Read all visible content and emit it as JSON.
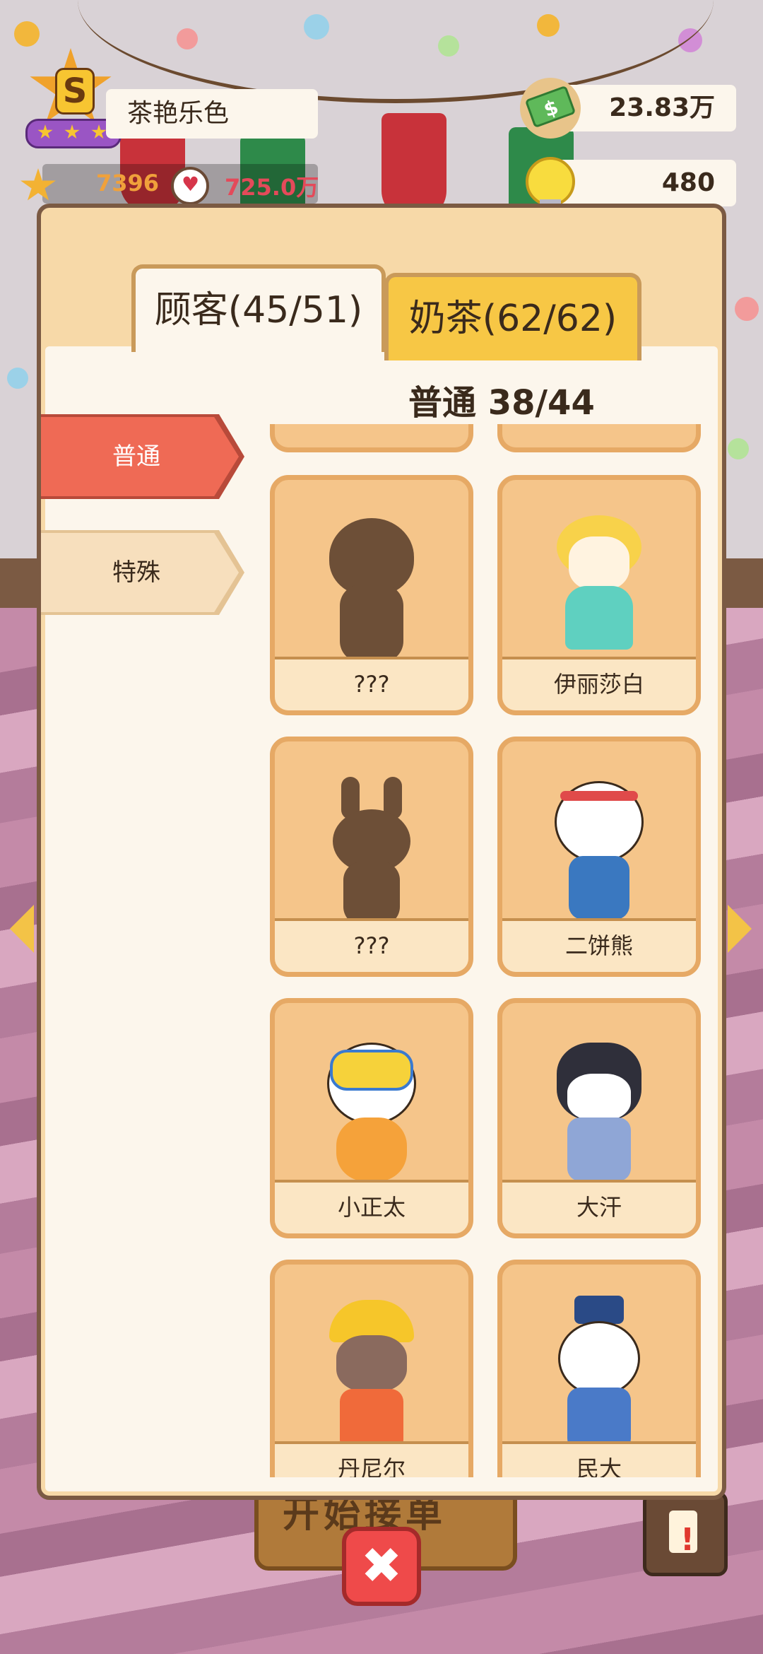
{
  "player": {
    "rank_letter": "S",
    "shop_name": "茶艳乐色",
    "stars": "7396",
    "fans": "725.0万"
  },
  "currency": {
    "money": "23.83万",
    "ideas": "480"
  },
  "tabs": [
    {
      "label": "顾客(45/51)",
      "active": true
    },
    {
      "label": "奶茶(62/62)",
      "active": false
    }
  ],
  "section": {
    "title": "普通 38/44"
  },
  "categories": [
    {
      "label": "普通",
      "active": true
    },
    {
      "label": "特殊",
      "active": false
    }
  ],
  "customers": [
    {
      "name": "???",
      "unlocked": false
    },
    {
      "name": "伊丽莎白",
      "unlocked": true
    },
    {
      "name": "???",
      "unlocked": false
    },
    {
      "name": "二饼熊",
      "unlocked": true
    },
    {
      "name": "小正太",
      "unlocked": true
    },
    {
      "name": "大汗",
      "unlocked": true
    },
    {
      "name": "丹尼尔",
      "unlocked": true
    },
    {
      "name": "民大",
      "unlocked": true
    }
  ],
  "background": {
    "start_button_label": "开始接单"
  },
  "controls": {
    "close_label": "✖"
  },
  "icons": [
    "rank-star-icon",
    "star-icon",
    "heart-icon",
    "money-icon",
    "bulb-icon",
    "close-icon",
    "alert-icon"
  ],
  "colors": {
    "active_category": "#ef6a55",
    "active_tab": "#fcf6ec",
    "inactive_tab": "#f7c745",
    "card_bg": "#f5c58a",
    "close_button": "#ef4a4a"
  }
}
